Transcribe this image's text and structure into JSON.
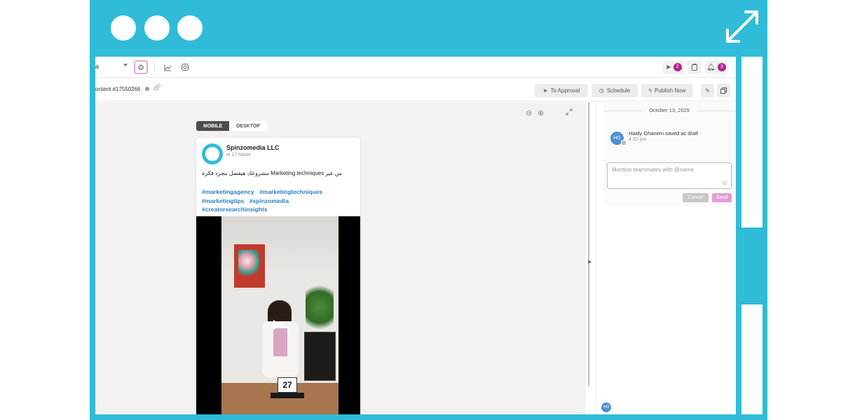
{
  "toolbar": {
    "select_value": "a",
    "approval_badge": "2",
    "notification_badge": "3"
  },
  "content": {
    "id_label": "ontent #17550266",
    "actions": {
      "approval": "To Approval",
      "schedule": "Schedule",
      "publish": "Publish Now"
    }
  },
  "preview": {
    "tabs": [
      "MOBILE",
      "DESKTOP"
    ],
    "page_name": "Spinzomedia LLC",
    "time": "in 17 hours",
    "caption": "مشروعك هيفضل مجرد فكرة Marketing techniques من غير",
    "hashtags": [
      "#marketingagency",
      "#marketingtechniques",
      "#marketingtips",
      "#spinzomedia",
      "#creatorsearchinsights"
    ],
    "counter": "27"
  },
  "activity": {
    "date": "October 13, 2025",
    "avatar_initials": "HG",
    "text": "Haidy Ghanem saved as draft",
    "time": "4:32 pm",
    "comment_placeholder": "Mention teammates with @name",
    "cancel_label": "Cancel",
    "send_label": "Send"
  },
  "colors": {
    "brand": "#30bcd8",
    "accent": "#b0278f",
    "send": "#e39dd6",
    "cancel": "#c7c7c7",
    "hashtag": "#2b7fbe"
  }
}
